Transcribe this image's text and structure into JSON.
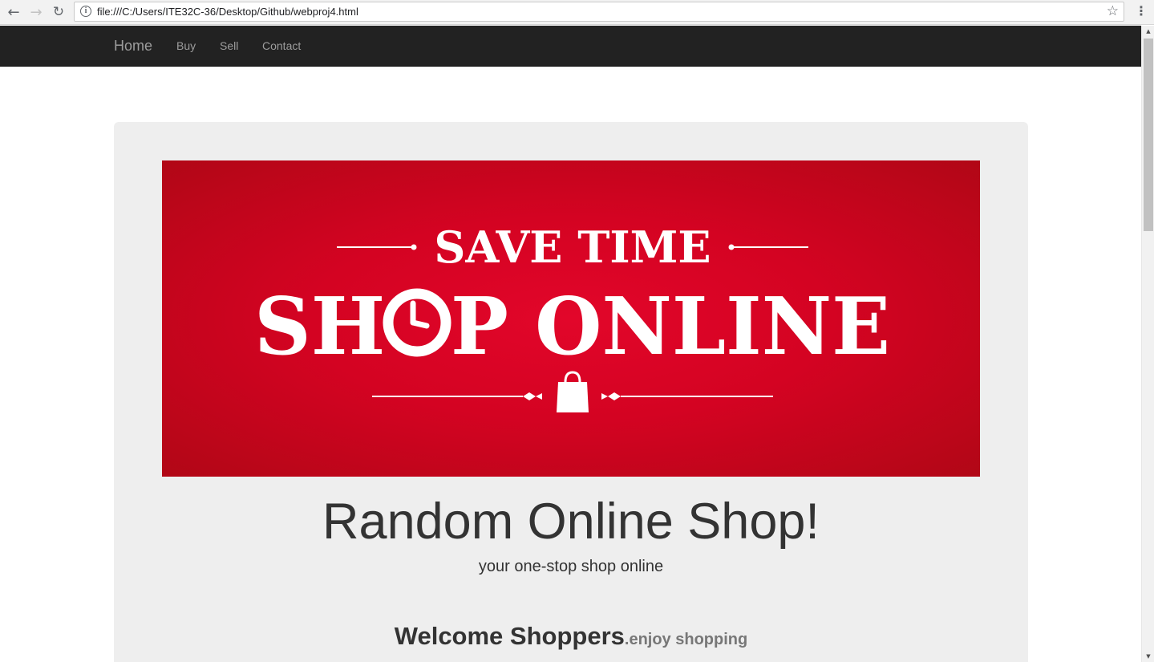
{
  "browser": {
    "url": "file:///C:/Users/ITE32C-36/Desktop/Github/webproj4.html"
  },
  "navbar": {
    "brand": "Home",
    "links": [
      "Buy",
      "Sell",
      "Contact"
    ]
  },
  "banner": {
    "line1": "SAVE TIME",
    "line2_part1": "SH",
    "line2_part2": "P ONLINE"
  },
  "jumbotron": {
    "headline": "Random Online Shop!",
    "tagline": "your one-stop shop online",
    "welcome": "Welcome Shoppers",
    "welcome_small": ".enjoy shopping"
  },
  "colors": {
    "navbar_bg": "#222222",
    "banner_red": "#d40322",
    "jumbotron_bg": "#eeeeee"
  }
}
